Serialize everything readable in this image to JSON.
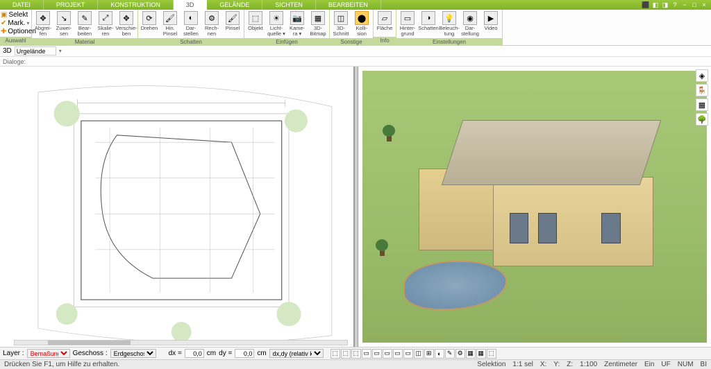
{
  "menu": {
    "tabs": [
      "DATEI",
      "PROJEKT",
      "KONSTRUKTION",
      "3D",
      "GELÄNDE",
      "SICHTEN",
      "BEARBEITEN"
    ],
    "active": 3
  },
  "titleicons": [
    "⬛",
    "◧",
    "◨",
    "?",
    "−",
    "□",
    "×"
  ],
  "ribbon": {
    "sel": {
      "selekt": "Selekt",
      "mark": "Mark.",
      "opt": "Optionen",
      "label": "Auswahl"
    },
    "groups": [
      {
        "label": "Material",
        "btns": [
          {
            "t": "Abgrei-\nfen",
            "i": "✥"
          },
          {
            "t": "Zuwei-\nsen",
            "i": "↘"
          },
          {
            "t": "Bear-\nbeiten",
            "i": "✎"
          },
          {
            "t": "Skalie-\nren",
            "i": "⤢"
          },
          {
            "t": "Verschie-\nben",
            "i": "✥"
          }
        ]
      },
      {
        "label": "Schatten",
        "btns": [
          {
            "t": "Drehen",
            "i": "⟳"
          },
          {
            "t": "Hin.\nPinsel",
            "i": "🖌"
          },
          {
            "t": "Dar-\nstellen",
            "i": "◐"
          },
          {
            "t": "Rech-\nnen",
            "i": "⚙"
          },
          {
            "t": "Pinsel",
            "i": "🖌"
          }
        ]
      },
      {
        "label": "Einfügen",
        "btns": [
          {
            "t": "Objekt",
            "i": "⬚"
          },
          {
            "t": "Licht-\nquelle ▾",
            "i": "☀"
          },
          {
            "t": "Kame-\nra ▾",
            "i": "📷"
          },
          {
            "t": "3D-\nBitmap",
            "i": "▦"
          }
        ]
      },
      {
        "label": "Sonstige",
        "btns": [
          {
            "t": "3D-\nSchnitt",
            "i": "◫"
          },
          {
            "t": "Kolli-\nsion",
            "i": "⬤",
            "hl": true
          }
        ]
      },
      {
        "label": "Info",
        "btns": [
          {
            "t": "Fläche",
            "i": "▱"
          }
        ]
      },
      {
        "label": "Einstellungen",
        "btns": [
          {
            "t": "Hinter-\ngrund",
            "i": "▭"
          },
          {
            "t": "Schatten",
            "i": "◑"
          },
          {
            "t": "Beleuch-\ntung",
            "i": "💡"
          },
          {
            "t": "Dar-\nstellung",
            "i": "◉"
          },
          {
            "t": "Video",
            "i": "▶"
          }
        ]
      }
    ]
  },
  "subbar": {
    "prefix": "3D",
    "terrain": "Urgelände",
    "dd": "▾"
  },
  "dlg": "Dialoge:",
  "bottom": {
    "layer_lbl": "Layer :",
    "layer_val": "Bemaßung",
    "geschoss_lbl": "Geschoss :",
    "geschoss_val": "Erdgeschos",
    "dx": "dx =",
    "dy": "dy =",
    "val": "0,0",
    "cm": "cm",
    "rel": "dx,dy (relativ ka",
    "icons": [
      "⬚",
      "⬚",
      "⬚",
      "▭",
      "▭",
      "▭",
      "▭",
      "▭",
      "◫",
      "⊞",
      "◐",
      "✎",
      "⚙",
      "▦",
      "▦",
      "⬚"
    ]
  },
  "status": {
    "help": "Drücken Sie F1, um Hilfe zu erhalten.",
    "sel": "Selektion",
    "ratio": "1:1 sel",
    "x": "X:",
    "y": "Y:",
    "z": "Z:",
    "scale": "1:100",
    "unit": "Zentimeter",
    "ein": "Ein",
    "uf": "UF",
    "num": "NUM",
    "bl": "BI"
  },
  "float": [
    "◈",
    "🪑",
    "▦",
    "🌳"
  ]
}
